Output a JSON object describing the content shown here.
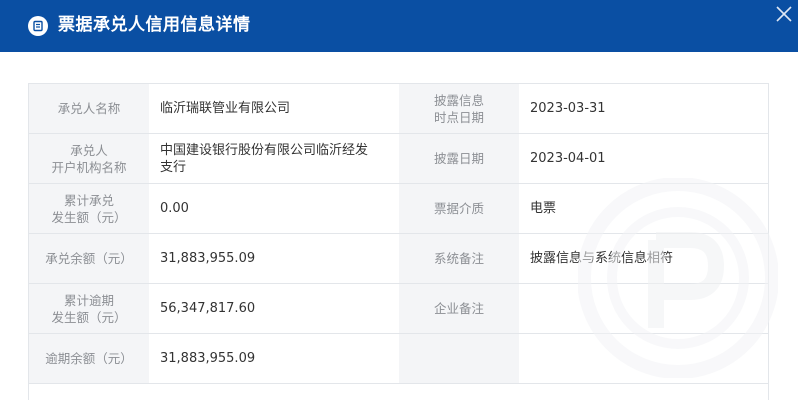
{
  "header": {
    "title": "票据承兑人信用信息详情",
    "logo_icon": "ticket-icon",
    "close_icon": "close-icon",
    "bg_color": "#0a4fa3"
  },
  "rows": [
    {
      "l1": "承兑人名称",
      "v1": "临沂瑞联管业有限公司",
      "l2": "披露信息\n时点日期",
      "v2": "2023-03-31"
    },
    {
      "l1": "承兑人\n开户机构名称",
      "v1": "中国建设银行股份有限公司临沂经发\n支行",
      "l2": "披露日期",
      "v2": "2023-04-01"
    },
    {
      "l1": "累计承兑\n发生额（元）",
      "v1": "0.00",
      "l2": "票据介质",
      "v2": "电票"
    },
    {
      "l1": "承兑余额（元）",
      "v1": "31,883,955.09",
      "l2": "系统备注",
      "v2": "披露信息与系统信息相符"
    },
    {
      "l1": "累计逾期\n发生额（元）",
      "v1": "56,347,817.60",
      "l2": "企业备注",
      "v2": ""
    },
    {
      "l1": "逾期余额（元）",
      "v1": "31,883,955.09",
      "l2": "",
      "v2": ""
    }
  ]
}
